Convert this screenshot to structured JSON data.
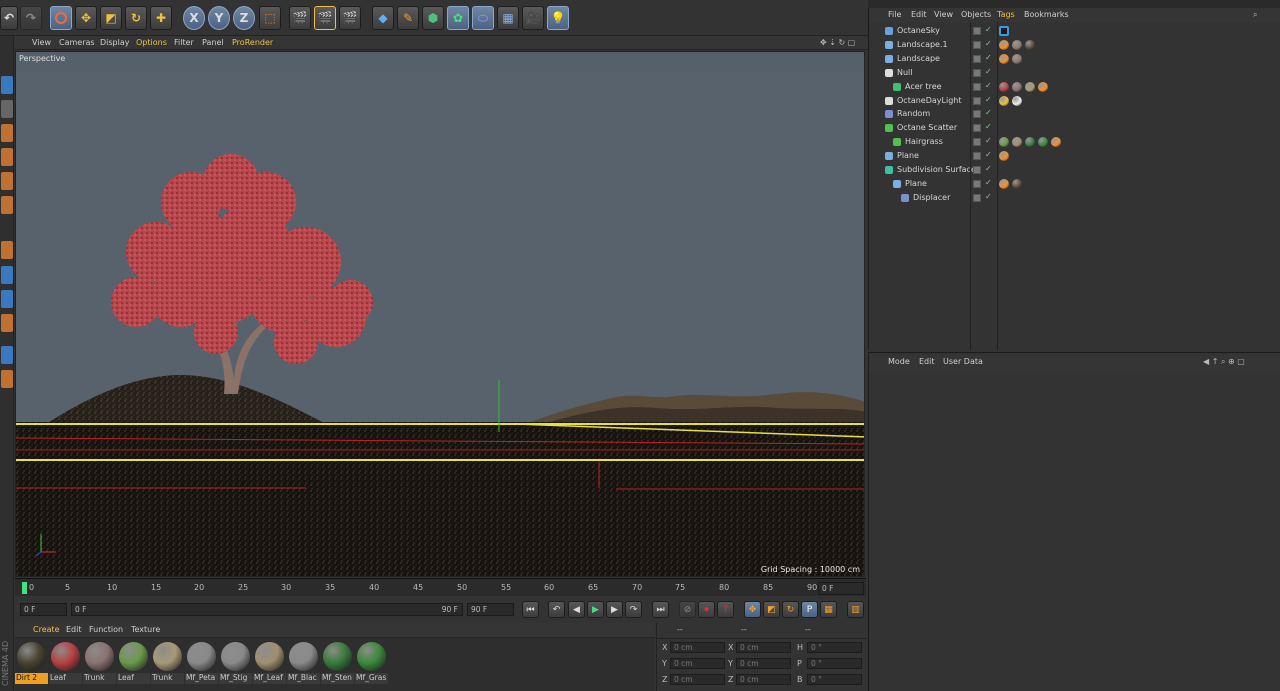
{
  "toolbar": {
    "axis_x": "X",
    "axis_y": "Y",
    "axis_z": "Z",
    "icons": [
      "undo-icon",
      "redo-icon",
      "select-icon",
      "move-icon",
      "scale-icon",
      "rotate-icon",
      "add-icon",
      "x-axis",
      "y-axis",
      "z-axis",
      "coord-system",
      "render-view",
      "render-picture",
      "edit-render",
      "cube",
      "pen",
      "subdivision",
      "mograph",
      "deformer",
      "floor",
      "camera",
      "light"
    ]
  },
  "viewport": {
    "menu": [
      "View",
      "Cameras",
      "Display",
      "Options",
      "Filter",
      "Panel",
      "ProRender"
    ],
    "label": "Perspective",
    "grid_spacing": "Grid Spacing : 10000 cm"
  },
  "timeline": {
    "ticks": [
      "0",
      "5",
      "10",
      "15",
      "20",
      "25",
      "30",
      "35",
      "40",
      "45",
      "50",
      "55",
      "60",
      "65",
      "70",
      "75",
      "80",
      "85",
      "90"
    ],
    "current_frame": "0 F"
  },
  "playback": {
    "start": "0 F",
    "range_start": "0 F",
    "range_end": "90 F",
    "end": "90 F"
  },
  "materials": {
    "menu": [
      "Create",
      "Edit",
      "Function",
      "Texture"
    ],
    "items": [
      {
        "label": "Dirt 2",
        "color": "#4a4232",
        "selected": true
      },
      {
        "label": "Leaf",
        "color": "#b84040",
        "selected": false
      },
      {
        "label": "Trunk",
        "color": "#8a7270",
        "selected": false
      },
      {
        "label": "Leaf",
        "color": "#6a9a4a",
        "selected": false
      },
      {
        "label": "Trunk",
        "color": "#a89a78",
        "selected": false
      },
      {
        "label": "Mf_Peta",
        "color": "#8a8a8a",
        "selected": false
      },
      {
        "label": "Mf_Stig",
        "color": "#8a8a8a",
        "selected": false
      },
      {
        "label": "Mf_Leaf",
        "color": "#a09070",
        "selected": false
      },
      {
        "label": "Mf_Blac",
        "color": "#8a8a8a",
        "selected": false
      },
      {
        "label": "Mf_Sten",
        "color": "#3a7a3a",
        "selected": false
      },
      {
        "label": "Mf_Gras",
        "color": "#3a8a3a",
        "selected": false
      }
    ]
  },
  "coordinates": {
    "header": [
      "--",
      "--",
      "--"
    ],
    "rows": [
      {
        "a": "X",
        "av": "0 cm",
        "b": "X",
        "bv": "0 cm",
        "c": "H",
        "cv": "0 °"
      },
      {
        "a": "Y",
        "av": "0 cm",
        "b": "Y",
        "bv": "0 cm",
        "c": "P",
        "cv": "0 °"
      },
      {
        "a": "Z",
        "av": "0 cm",
        "b": "Z",
        "bv": "0 cm",
        "c": "B",
        "cv": "0 °"
      }
    ]
  },
  "object_manager": {
    "menu": [
      "File",
      "Edit",
      "View",
      "Objects",
      "Tags",
      "Bookmarks"
    ],
    "objects": [
      {
        "name": "OctaneSky",
        "indent": 0,
        "icon": "#6aa0e0"
      },
      {
        "name": "Landscape.1",
        "indent": 0,
        "icon": "#7ab0e0"
      },
      {
        "name": "Landscape",
        "indent": 0,
        "icon": "#7ab0e0"
      },
      {
        "name": "Null",
        "indent": 0,
        "icon": "#dddddd"
      },
      {
        "name": "Acer tree",
        "indent": 1,
        "icon": "#40c070"
      },
      {
        "name": "OctaneDayLight",
        "indent": 0,
        "icon": "#dddddd"
      },
      {
        "name": "Random",
        "indent": 0,
        "icon": "#7a90d0"
      },
      {
        "name": "Octane Scatter",
        "indent": 0,
        "icon": "#50c050"
      },
      {
        "name": "Hairgrass",
        "indent": 1,
        "icon": "#50c050"
      },
      {
        "name": "Plane",
        "indent": 0,
        "icon": "#7ab0e0"
      },
      {
        "name": "Subdivision Surface",
        "indent": 0,
        "icon": "#40c0a0"
      },
      {
        "name": "Plane",
        "indent": 1,
        "icon": "#7ab0e0"
      },
      {
        "name": "Displacer",
        "indent": 2,
        "icon": "#7a90d0"
      }
    ]
  },
  "attributes": {
    "menu": [
      "Mode",
      "Edit",
      "User Data"
    ]
  },
  "app": {
    "side_label": "CINEMA 4D"
  }
}
